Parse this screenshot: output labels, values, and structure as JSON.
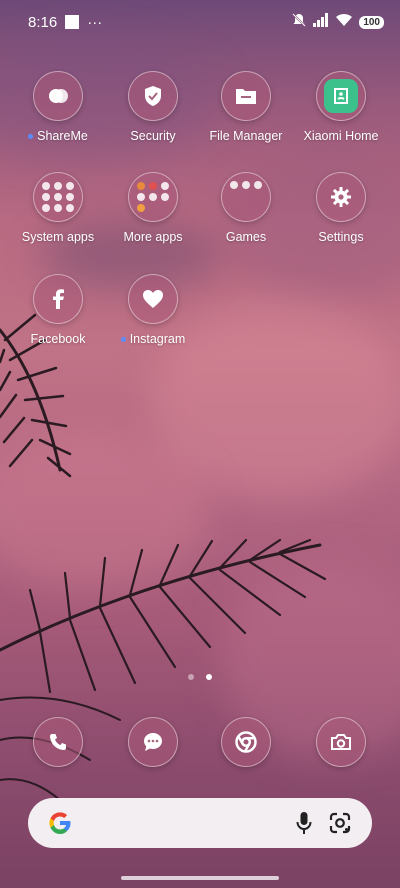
{
  "status_bar": {
    "time": "8:16",
    "more_indicator": "···",
    "battery": "100",
    "icons": [
      "notification-icon",
      "mute-icon",
      "signal-icon",
      "wifi-icon",
      "battery-icon"
    ]
  },
  "apps": [
    {
      "label": "ShareMe",
      "icon": "shareme-icon",
      "new_dot": true
    },
    {
      "label": "Security",
      "icon": "security-shield-icon",
      "new_dot": false
    },
    {
      "label": "File Manager",
      "icon": "folder-icon",
      "new_dot": false
    },
    {
      "label": "Xiaomi Home",
      "icon": "xiaomi-home-icon",
      "new_dot": false
    },
    {
      "label": "System apps",
      "icon": "folder-grid-icon",
      "new_dot": false
    },
    {
      "label": "More apps",
      "icon": "folder-grid-icon",
      "new_dot": false
    },
    {
      "label": "Games",
      "icon": "folder-grid-icon",
      "new_dot": false
    },
    {
      "label": "Settings",
      "icon": "gear-icon",
      "new_dot": false
    },
    {
      "label": "Facebook",
      "icon": "facebook-icon",
      "new_dot": false
    },
    {
      "label": "Instagram",
      "icon": "heart-icon",
      "new_dot": true
    }
  ],
  "page_indicator": {
    "pages": 2,
    "current": 2
  },
  "dock": [
    {
      "icon": "phone-icon"
    },
    {
      "icon": "messages-icon"
    },
    {
      "icon": "chrome-icon"
    },
    {
      "icon": "camera-icon"
    }
  ],
  "search_bar": {
    "icons": [
      "google-logo-icon",
      "microphone-icon",
      "lens-icon"
    ]
  },
  "colors": {
    "accent_dot": "#5a8cff",
    "xiaomi_home": "#3cc08c"
  }
}
